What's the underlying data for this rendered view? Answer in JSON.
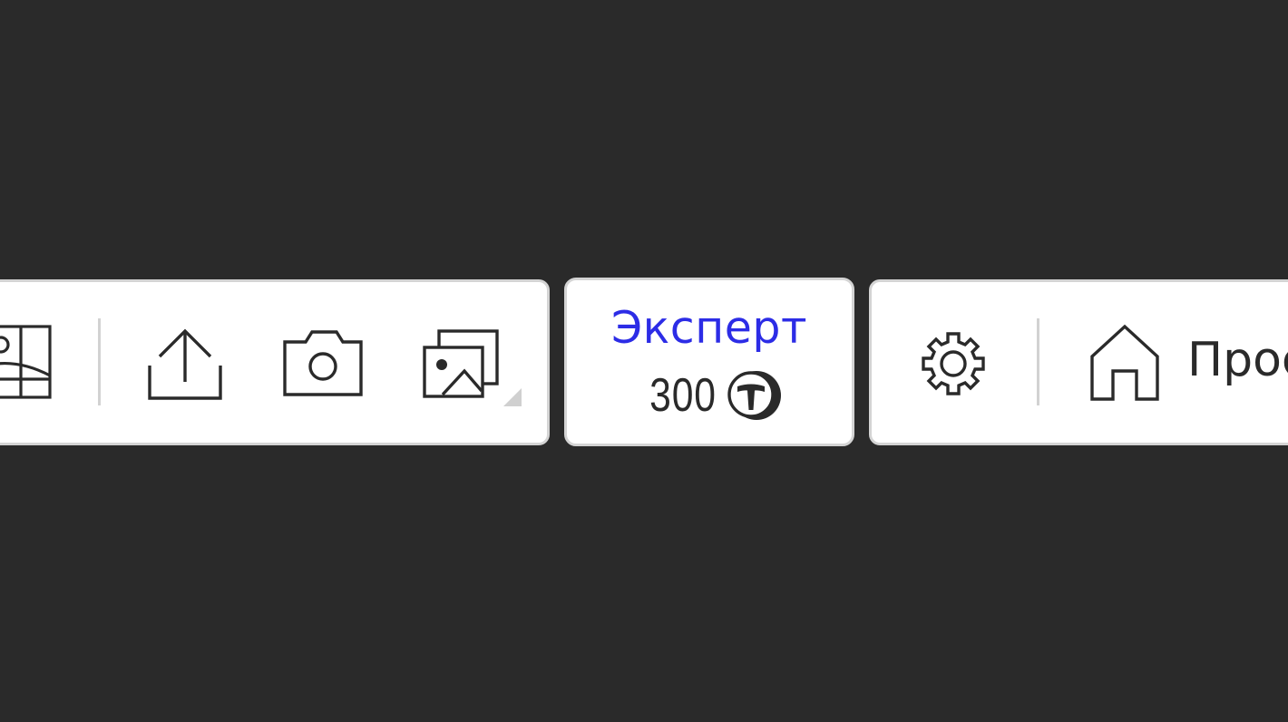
{
  "toolbar_left": {
    "icons": {
      "map": "map-view-icon",
      "upload": "upload-icon",
      "camera": "camera-icon",
      "gallery": "image-gallery-icon"
    }
  },
  "mode_badge": {
    "title": "Эксперт",
    "price": "300",
    "currency_icon": "token-coin-icon"
  },
  "toolbar_right": {
    "settings_icon": "gear-icon",
    "home_icon": "home-icon",
    "home_label": "Проє"
  },
  "colors": {
    "background": "#2a2a2a",
    "panel": "#ffffff",
    "panel_border": "#d4d4d4",
    "accent": "#2c2ce6",
    "icon_stroke": "#2a2a2a"
  }
}
